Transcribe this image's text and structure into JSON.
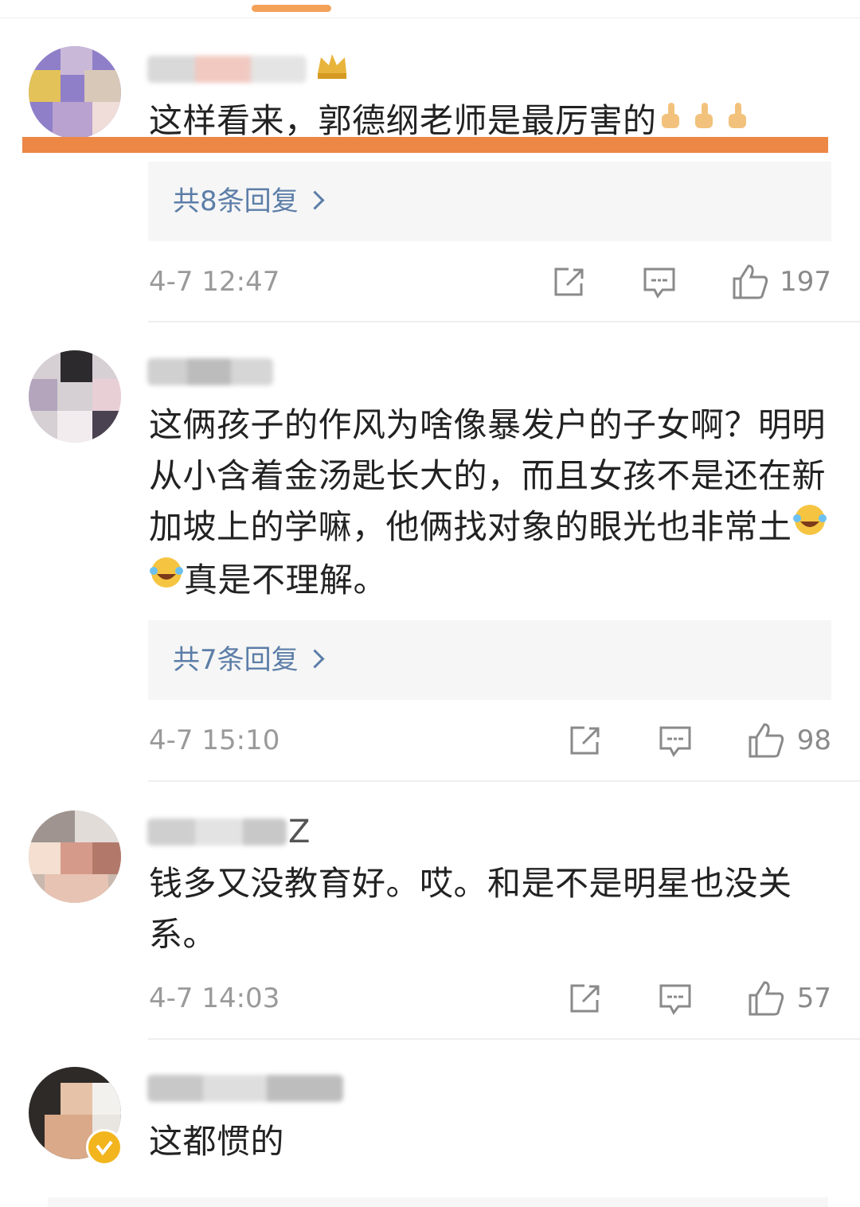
{
  "comments": [
    {
      "text": "这样看来，郭德纲老师是最厉害的",
      "replies": "共8条回复",
      "time": "4-7 12:47",
      "likes": "197"
    },
    {
      "text_parts": [
        "这俩孩子的作风为啥像暴发户的子女啊？明明从小含着金汤匙长大的，而且女孩不是还在新加坡上的学嘛，他俩找对象的眼光也非常土",
        "真是不理解。"
      ],
      "replies": "共7条回复",
      "time": "4-7 15:10",
      "likes": "98"
    },
    {
      "username_visible": "Z",
      "text": "钱多又没教育好。哎。和是不是明星也没关系。",
      "time": "4-7 14:03",
      "likes": "57"
    },
    {
      "text": "这都惯的"
    }
  ],
  "icons": {
    "share": "share-icon",
    "comment": "comment-icon",
    "like": "thumbs-up-icon",
    "emoji_thumb": "thumbs-up-emoji",
    "emoji_laugh": "laughing-crying-emoji",
    "verified": "verified-badge-icon"
  },
  "colors": {
    "highlight": "#ec8746",
    "reply_link": "#5c7ea8",
    "meta_text": "#9a9a9a"
  }
}
